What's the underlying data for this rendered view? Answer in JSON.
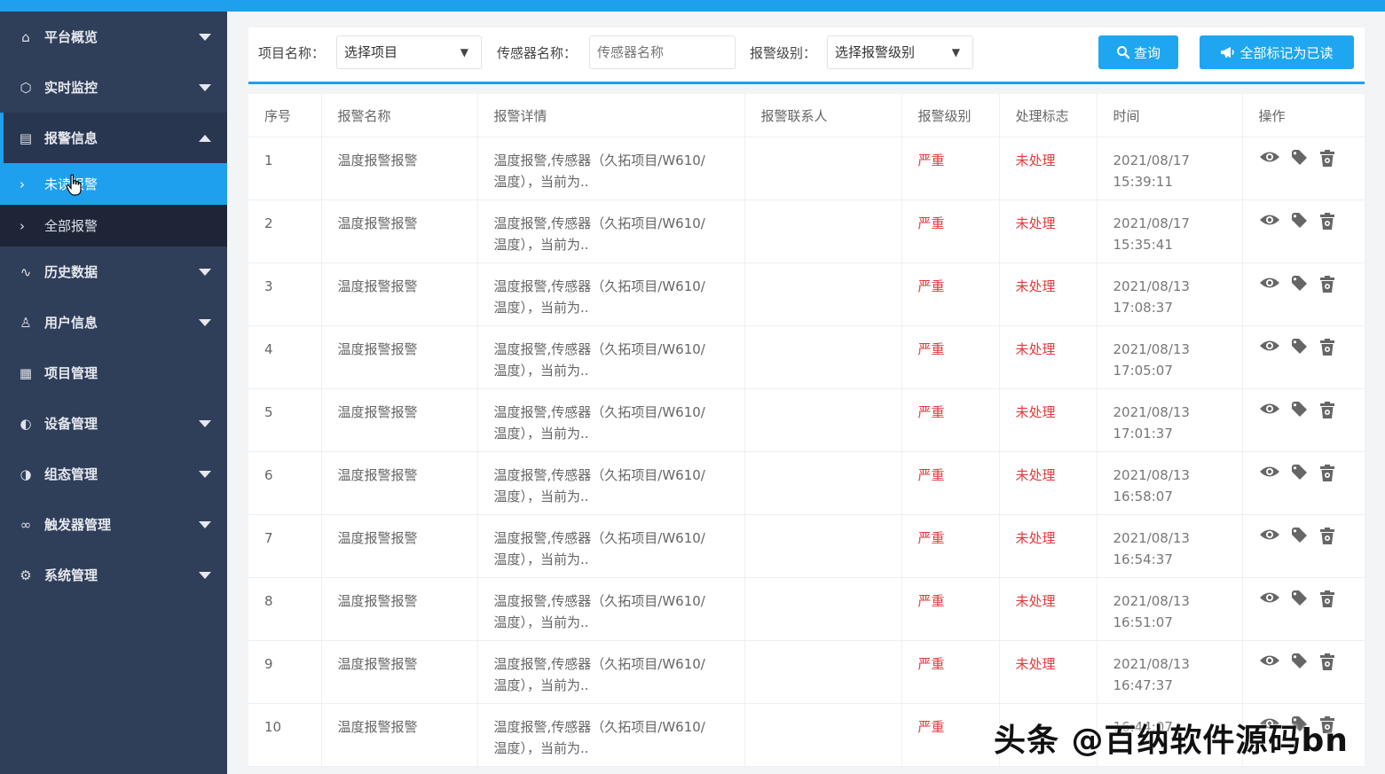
{
  "colors": {
    "accent": "#1ea0ee",
    "sidebar": "#2f3e59",
    "danger": "#e4393c"
  },
  "sidebar": {
    "items": [
      {
        "label": "平台概览",
        "icon": "home-icon",
        "expanded": false
      },
      {
        "label": "实时监控",
        "icon": "cube-icon",
        "expanded": false
      },
      {
        "label": "报警信息",
        "icon": "alarm-list-icon",
        "expanded": true,
        "children": [
          {
            "label": "未读报警",
            "active": true
          },
          {
            "label": "全部报警",
            "active": false
          }
        ]
      },
      {
        "label": "历史数据",
        "icon": "pulse-icon",
        "expanded": false
      },
      {
        "label": "用户信息",
        "icon": "user-icon",
        "expanded": false
      },
      {
        "label": "项目管理",
        "icon": "grid-icon"
      },
      {
        "label": "设备管理",
        "icon": "device-icon",
        "expanded": false
      },
      {
        "label": "组态管理",
        "icon": "config-icon",
        "expanded": false
      },
      {
        "label": "触发器管理",
        "icon": "link-icon",
        "expanded": false
      },
      {
        "label": "系统管理",
        "icon": "gear-icon",
        "expanded": false
      }
    ]
  },
  "filters": {
    "project_label": "项目名称：",
    "project_value": "选择项目",
    "sensor_label": "传感器名称：",
    "sensor_placeholder": "传感器名称",
    "level_label": "报警级别：",
    "level_value": "选择报警级别",
    "query_button": "查询",
    "mark_all_button": "全部标记为已读"
  },
  "table": {
    "columns": [
      "序号",
      "报警名称",
      "报警详情",
      "报警联系人",
      "报警级别",
      "处理标志",
      "时间",
      "操作"
    ],
    "rows": [
      {
        "no": "1",
        "name": "温度报警报警",
        "detail1": "温度报警,传感器（久拓项目/W610/",
        "detail2": "温度），当前为..",
        "contact": "",
        "level": "严重",
        "status": "未处理",
        "date": "2021/08/17",
        "time": "15:39:11"
      },
      {
        "no": "2",
        "name": "温度报警报警",
        "detail1": "温度报警,传感器（久拓项目/W610/",
        "detail2": "温度），当前为..",
        "contact": "",
        "level": "严重",
        "status": "未处理",
        "date": "2021/08/17",
        "time": "15:35:41"
      },
      {
        "no": "3",
        "name": "温度报警报警",
        "detail1": "温度报警,传感器（久拓项目/W610/",
        "detail2": "温度），当前为..",
        "contact": "",
        "level": "严重",
        "status": "未处理",
        "date": "2021/08/13",
        "time": "17:08:37"
      },
      {
        "no": "4",
        "name": "温度报警报警",
        "detail1": "温度报警,传感器（久拓项目/W610/",
        "detail2": "温度），当前为..",
        "contact": "",
        "level": "严重",
        "status": "未处理",
        "date": "2021/08/13",
        "time": "17:05:07"
      },
      {
        "no": "5",
        "name": "温度报警报警",
        "detail1": "温度报警,传感器（久拓项目/W610/",
        "detail2": "温度），当前为..",
        "contact": "",
        "level": "严重",
        "status": "未处理",
        "date": "2021/08/13",
        "time": "17:01:37"
      },
      {
        "no": "6",
        "name": "温度报警报警",
        "detail1": "温度报警,传感器（久拓项目/W610/",
        "detail2": "温度），当前为..",
        "contact": "",
        "level": "严重",
        "status": "未处理",
        "date": "2021/08/13",
        "time": "16:58:07"
      },
      {
        "no": "7",
        "name": "温度报警报警",
        "detail1": "温度报警,传感器（久拓项目/W610/",
        "detail2": "温度），当前为..",
        "contact": "",
        "level": "严重",
        "status": "未处理",
        "date": "2021/08/13",
        "time": "16:54:37"
      },
      {
        "no": "8",
        "name": "温度报警报警",
        "detail1": "温度报警,传感器（久拓项目/W610/",
        "detail2": "温度），当前为..",
        "contact": "",
        "level": "严重",
        "status": "未处理",
        "date": "2021/08/13",
        "time": "16:51:07"
      },
      {
        "no": "9",
        "name": "温度报警报警",
        "detail1": "温度报警,传感器（久拓项目/W610/",
        "detail2": "温度），当前为..",
        "contact": "",
        "level": "严重",
        "status": "未处理",
        "date": "2021/08/13",
        "time": "16:47:37"
      },
      {
        "no": "10",
        "name": "温度报警报警",
        "detail1": "温度报警,传感器（久拓项目/W610/",
        "detail2": "温度），当前为..",
        "contact": "",
        "level": "严重",
        "status": "",
        "date": "",
        "time": "16:44:07"
      }
    ]
  },
  "watermark": "头条 @百纳软件源码bn"
}
